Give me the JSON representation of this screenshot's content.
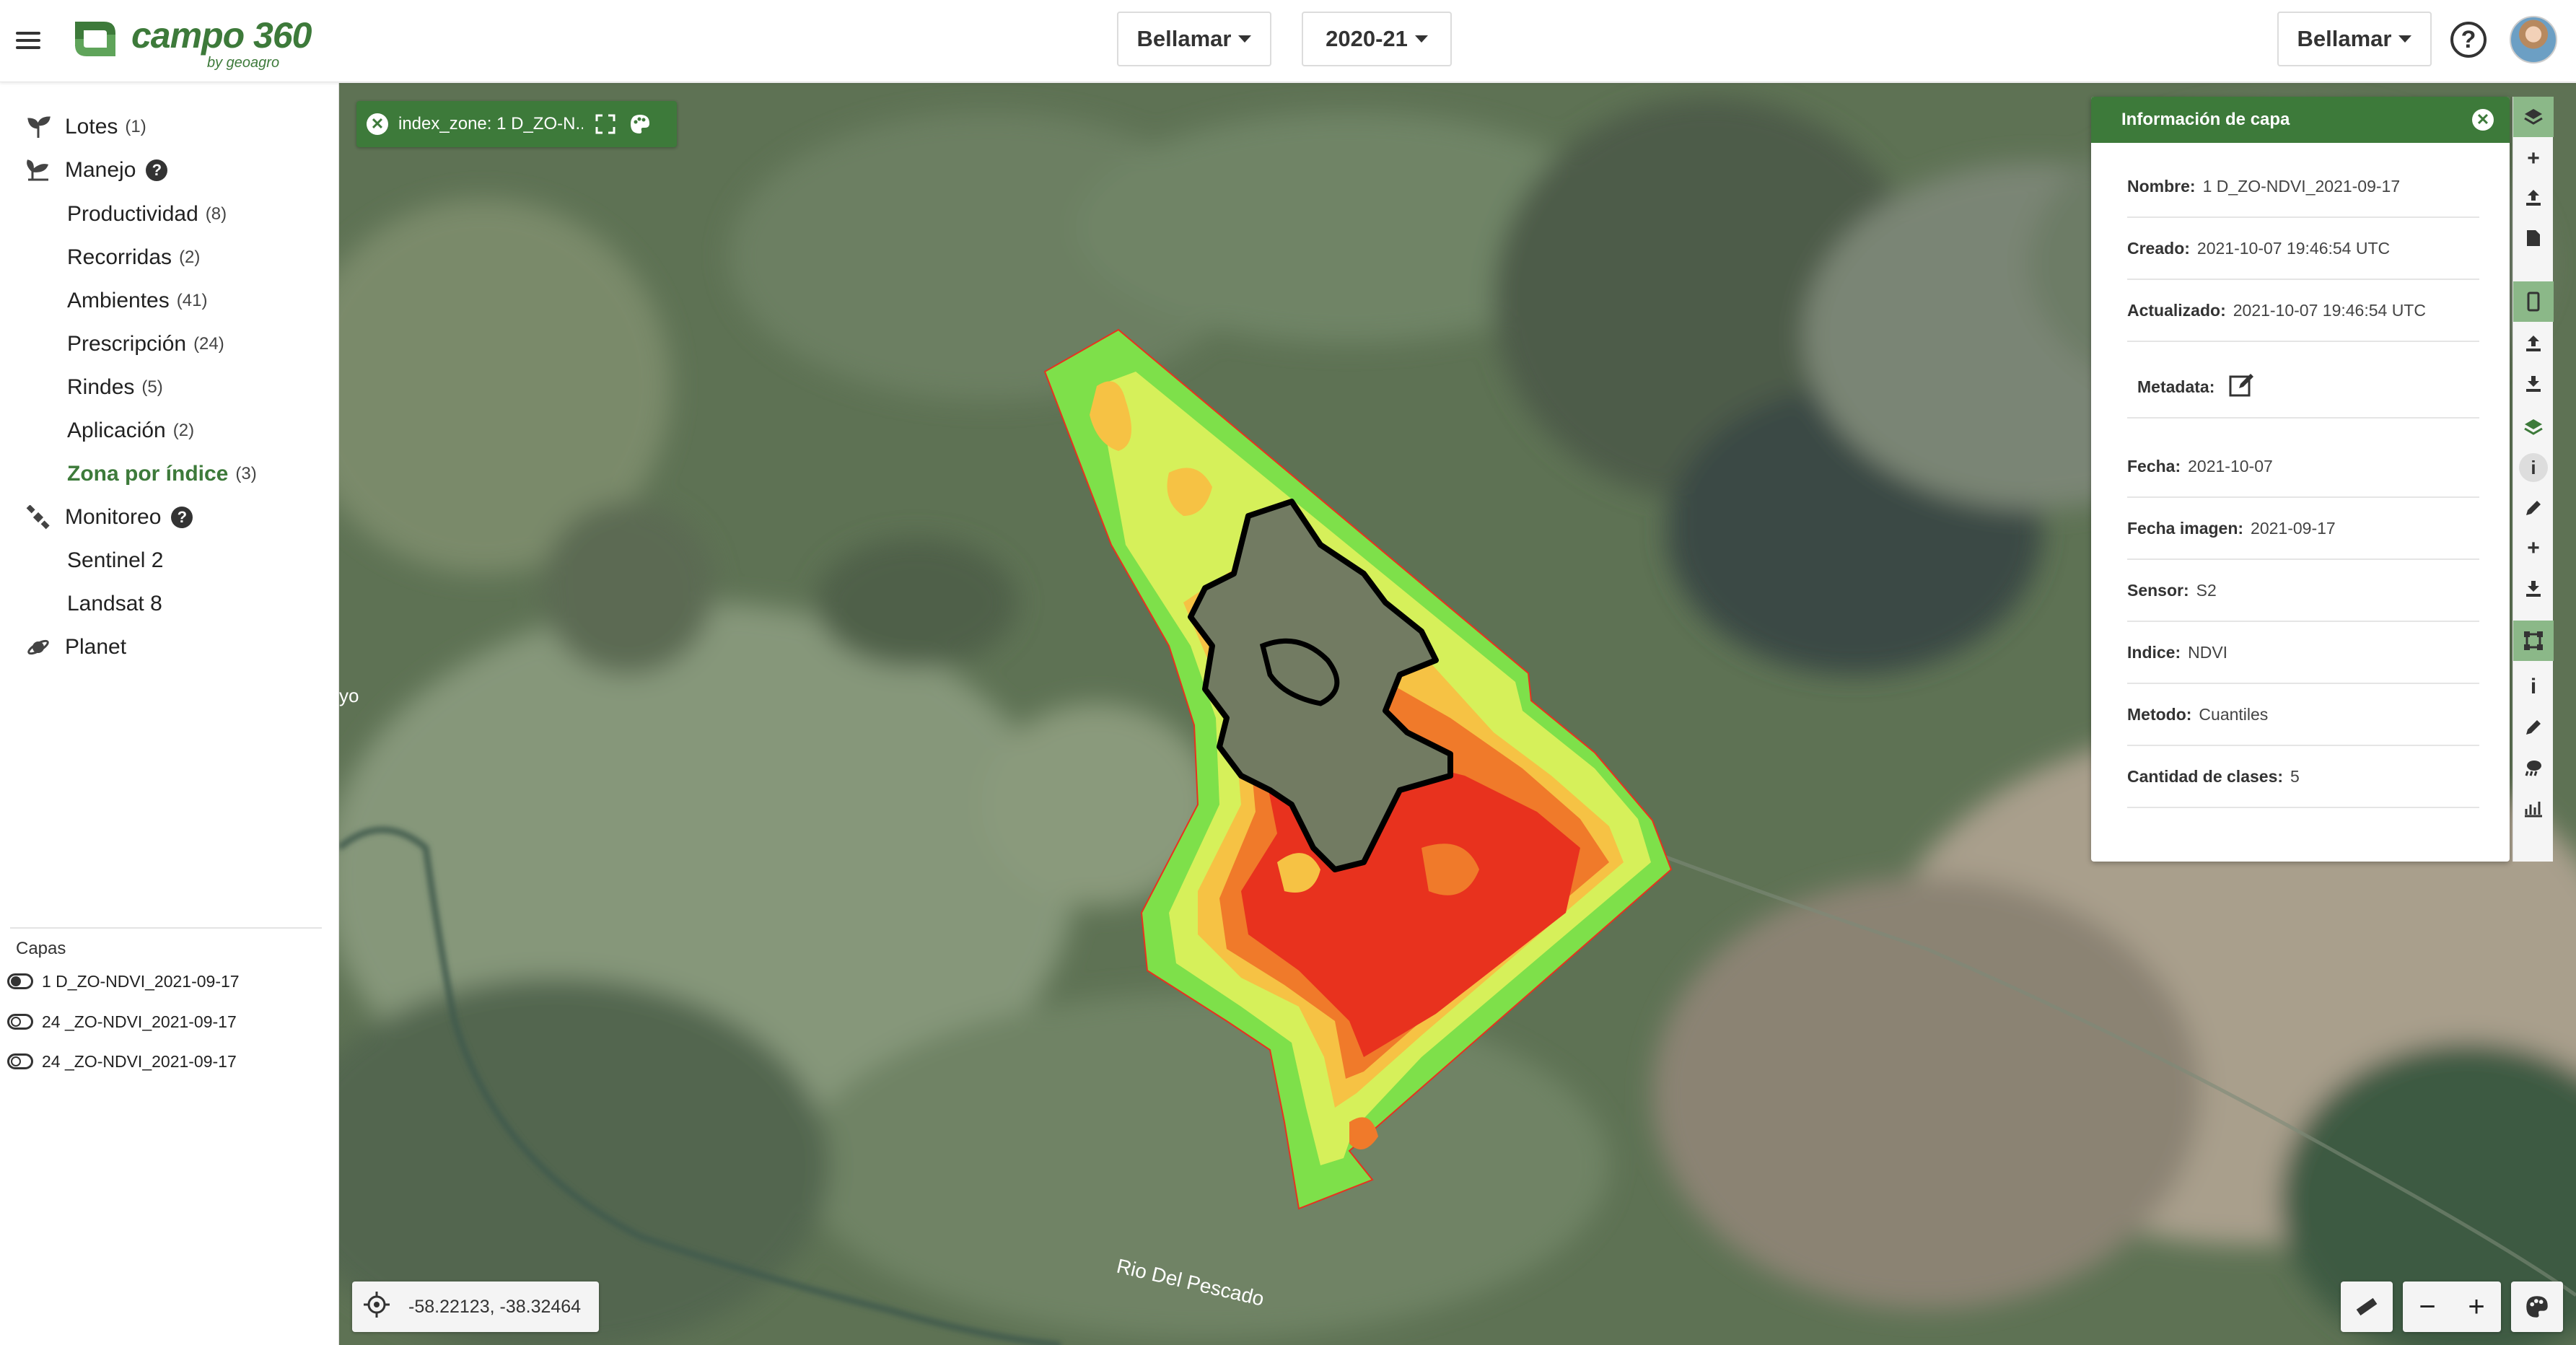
{
  "header": {
    "logo_text": "campo 360",
    "logo_sub": "by geoagro",
    "company_select": "Bellamar",
    "season_select": "2020-21",
    "account_select": "Bellamar",
    "help_symbol": "?"
  },
  "sidebar": {
    "items": [
      {
        "label": "Lotes",
        "count": "(1)"
      },
      {
        "label": "Manejo"
      },
      {
        "label": "Productividad",
        "count": "(8)"
      },
      {
        "label": "Recorridas",
        "count": "(2)"
      },
      {
        "label": "Ambientes",
        "count": "(41)"
      },
      {
        "label": "Prescripción",
        "count": "(24)"
      },
      {
        "label": "Rindes",
        "count": "(5)"
      },
      {
        "label": "Aplicación",
        "count": "(2)"
      },
      {
        "label": "Zona por índice",
        "count": "(3)"
      },
      {
        "label": "Monitoreo"
      },
      {
        "label": "Sentinel 2"
      },
      {
        "label": "Landsat 8"
      },
      {
        "label": "Planet"
      }
    ],
    "capas_title": "Capas",
    "layers": [
      {
        "label": "1 D_ZO-NDVI_2021-09-17",
        "on": true
      },
      {
        "label": "24 _ZO-NDVI_2021-09-17",
        "on": false
      },
      {
        "label": "24 _ZO-NDVI_2021-09-17",
        "on": false
      }
    ]
  },
  "map": {
    "chip_label": "index_zone: 1 D_ZO-N...",
    "river_label": "Rio Del Pescado",
    "edge_label": "yo",
    "coords": "-58.22123, -38.32464",
    "zoom_out": "−",
    "zoom_in": "+"
  },
  "info_panel": {
    "title": "Información de capa",
    "rows": [
      {
        "key": "Nombre:",
        "value": "1 D_ZO-NDVI_2021-09-17"
      },
      {
        "key": "Creado:",
        "value": "2021-10-07 19:46:54 UTC"
      },
      {
        "key": "Actualizado:",
        "value": "2021-10-07 19:46:54 UTC"
      },
      {
        "key": "Metadata:",
        "value": ""
      },
      {
        "key": "Fecha:",
        "value": "2021-10-07"
      },
      {
        "key": "Fecha imagen:",
        "value": "2021-09-17"
      },
      {
        "key": "Sensor:",
        "value": "S2"
      },
      {
        "key": "Indice:",
        "value": "NDVI"
      },
      {
        "key": "Metodo:",
        "value": "Cuantiles"
      },
      {
        "key": "Cantidad de clases:",
        "value": "5"
      }
    ]
  },
  "colors": {
    "brand": "#3d7a3a",
    "zone_1": "#e8321e",
    "zone_2": "#f07a2a",
    "zone_3": "#f6c244",
    "zone_4": "#d6f05a",
    "zone_5": "#7ee04a"
  }
}
